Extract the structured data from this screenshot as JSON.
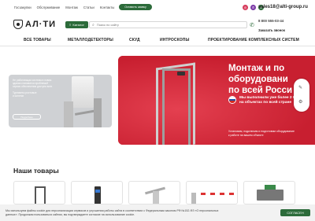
{
  "topbar": {
    "links": [
      "Госзакупки",
      "Обслуживание",
      "Монтаж",
      "Статьи",
      "Контакты"
    ],
    "call_button": "Оставить заявку",
    "email": "sales18@alti-group.ru"
  },
  "header": {
    "logo_text": "АЛ·ТИ",
    "catalog_button": "Каталог",
    "search_placeholder": "Поиск по сайту",
    "phone": "8 800 555-03-44",
    "callback_link": "Заказать звонок"
  },
  "nav": {
    "items": [
      "ВСЕ ТОВАРЫ",
      "МЕТАЛЛОДЕТЕКТОРЫ",
      "СКУД",
      "ИНТРОСКОПЫ",
      "ПРОЕКТИРОВАНИЕ КОМПЛЕКСНЫХ СИСТЕМ"
    ]
  },
  "promo": {
    "text": "Не работающая система в новом\nздании становится проблемой\nсервис обеспечения доступа всех\n\nТурникеты ростовые\nи калитки",
    "button": "Подробнее"
  },
  "hero": {
    "title": "Монтаж и по\nоборудовани\nпо всей Росси",
    "subtitle": "Мы выполнили уже более 2 000 м\nна объектах по всей стране",
    "description": "Установим, подключим и подготовим оборудование\nк работе на вашем объекте",
    "accent_color": "#d8293a"
  },
  "products": {
    "title": "Наши товары"
  },
  "cookie": {
    "text": "Мы используем файлы cookie для персонализации сервисов и улучшения работы сайта в соответствии с Федеральным законом РФ №152-ФЗ «О персональных\nданных». Продолжая пользоваться сайтом, вы подтверждаете согласие на использование cookie.",
    "button": "СОГЛАСЕН"
  },
  "colors": {
    "brand_green": "#2c6b3a",
    "hero_red": "#d8293a"
  }
}
